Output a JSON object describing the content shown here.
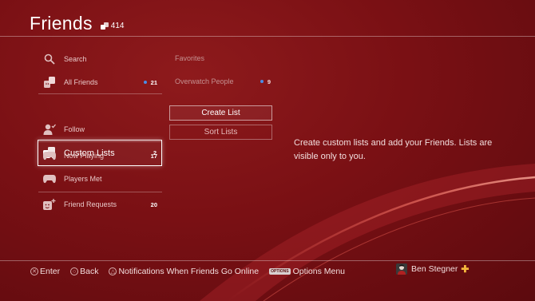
{
  "header": {
    "title": "Friends",
    "friend_count": "414"
  },
  "menu": {
    "items": [
      {
        "label": "Search",
        "icon": "search-icon",
        "count": ""
      },
      {
        "label": "All Friends",
        "icon": "friends-icon",
        "count": "21",
        "online_dot": true
      },
      {
        "label": "Custom Lists",
        "icon": "custom-lists-icon",
        "count": "2",
        "selected": true
      },
      {
        "label": "Follow",
        "icon": "follow-icon",
        "count": ""
      },
      {
        "label": "Now Playing",
        "icon": "gamepad-icon",
        "count": "17"
      },
      {
        "label": "Players Met",
        "icon": "gamepad-icon",
        "count": ""
      },
      {
        "label": "Friend Requests",
        "icon": "friend-request-icon",
        "count": "20"
      }
    ]
  },
  "lists": [
    {
      "label": "Favorites",
      "count": ""
    },
    {
      "label": "Overwatch People",
      "count": "9",
      "online_dot": true
    }
  ],
  "buttons": {
    "create": "Create List",
    "sort": "Sort Lists"
  },
  "info_text": "Create custom lists and add your Friends. Lists are visible only to you.",
  "footer": {
    "enter": "Enter",
    "enter_symbol": "✕",
    "back": "Back",
    "back_symbol": "○",
    "notifications": "Notifications When Friends Go Online",
    "notifications_symbol": "△",
    "options_badge": "OPTIONS",
    "options": "Options Menu"
  },
  "user": {
    "name": "Ben Stegner",
    "plus_symbol": "✚"
  },
  "colors": {
    "background": "#7a1014",
    "accent_dot": "#4a8ee8",
    "plus": "#f4b63c"
  }
}
